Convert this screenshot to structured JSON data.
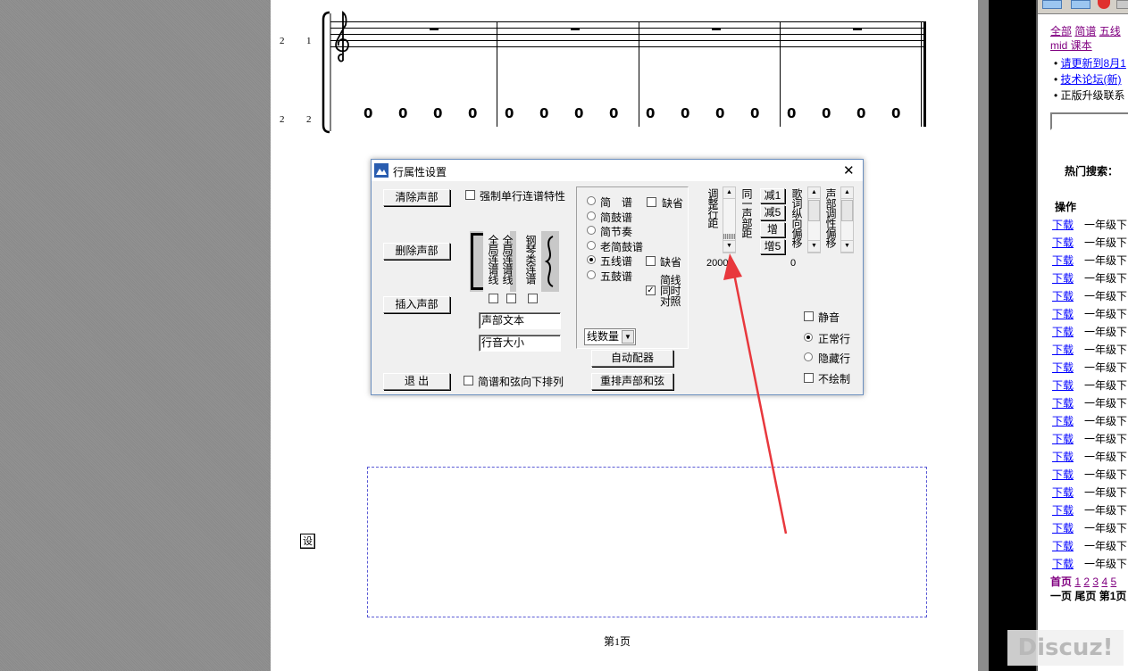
{
  "score": {
    "line_numbers": [
      {
        "left": "2",
        "right": "1"
      },
      {
        "left": "2",
        "right": "2"
      }
    ],
    "drum_row": [
      "0",
      "0",
      "0",
      "0",
      "0",
      "0",
      "0",
      "0",
      "0",
      "0",
      "0",
      "0",
      "0",
      "0",
      "0",
      "0"
    ],
    "side_button": "设",
    "page_footer": "第1页"
  },
  "dialog": {
    "title": "行属性设置",
    "close": "✕",
    "buttons": {
      "clear_voice": "清除声部",
      "delete_voice": "删除声部",
      "insert_voice": "插入声部",
      "exit": "退 出",
      "auto_chord": "自动配器",
      "rearrange": "重排声部和弦"
    },
    "force_single_line": "强制单行连谱特性",
    "arpeggio_note": "简谱和弦向下排列",
    "bracket_labels": {
      "full_line": "全局连谱线",
      "full_line2": "全局连谱线",
      "piano": "钢琴类连谱"
    },
    "voice_text": "声部文本",
    "line_pitch": "行音大小",
    "notation_options": [
      {
        "label": "简　谱",
        "checked": false
      },
      {
        "label": "简鼓谱",
        "checked": false
      },
      {
        "label": "简节奏",
        "checked": false
      },
      {
        "label": "老简鼓谱",
        "checked": false
      },
      {
        "label": "五线谱",
        "checked": true
      },
      {
        "label": "五鼓谱",
        "checked": false
      }
    ],
    "default1": "缺省",
    "default2": "缺省",
    "simple_compare": "简线同时对照",
    "simple_compare_checked": true,
    "line_count": "线数量",
    "adjust_spacing": "调整行距",
    "same_voice_spacing": "同一声部距",
    "dec1": "减1",
    "dec5": "减5",
    "inc": "增",
    "inc5": "增5",
    "lyric_offset": "歌词纵向偏移",
    "voice_offset": "声部调性偏移",
    "spacing_value": "2000",
    "offset_value": "0",
    "mute": "静音",
    "normal_row": "正常行",
    "hidden_row": "隐藏行",
    "no_draw": "不绘制",
    "row_mode": "正常行"
  },
  "browser": {
    "tabs": "全部 简谱 五线",
    "tab_items": [
      "全部",
      "简谱",
      "五线"
    ],
    "mid_link": "mid 课本",
    "bullets": [
      "请更新到8月1",
      "技术论坛(新)",
      "正版升级联系"
    ],
    "hot_search": "热门搜索：",
    "actions": "操作",
    "download": "下载",
    "row_text": "一年级下",
    "rows": 20,
    "pager": {
      "first": "首页",
      "pages": [
        "1",
        "2",
        "3",
        "4",
        "5"
      ],
      "prev": "一页",
      "last": "尾页",
      "trail": "第1页"
    }
  },
  "watermark": "Discuz!",
  "colors": {
    "arrow": "#e8383d",
    "accent": "#0000ff",
    "visited": "#800080"
  }
}
